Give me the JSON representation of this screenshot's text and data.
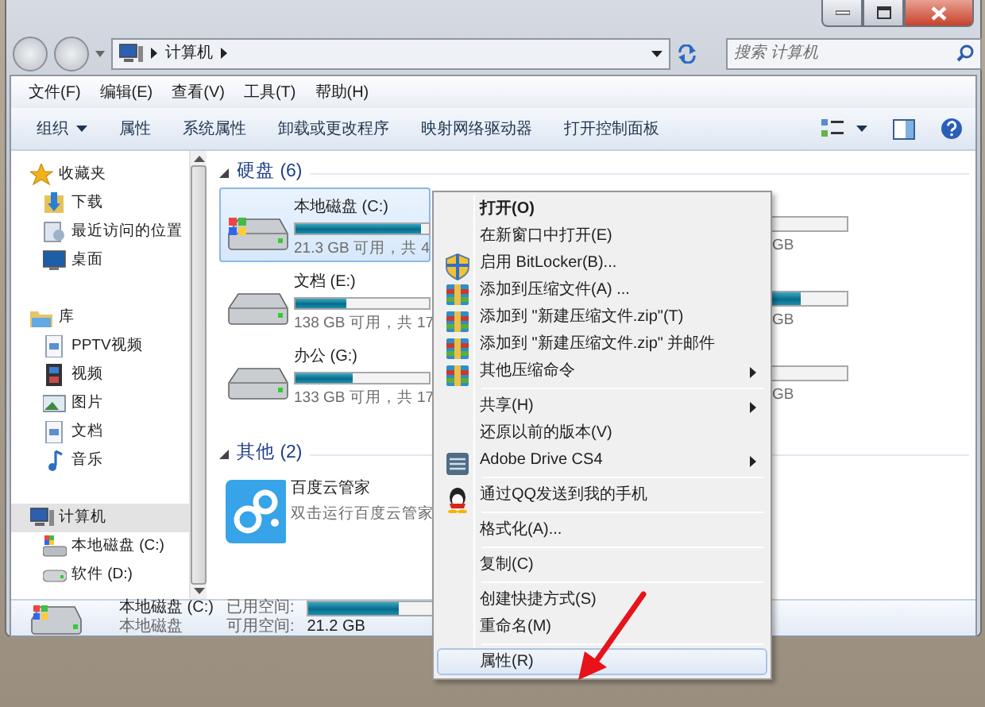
{
  "address_bar": {
    "path": "计算机"
  },
  "search": {
    "placeholder": "搜索 计算机"
  },
  "menu_bar": [
    "文件(F)",
    "编辑(E)",
    "查看(V)",
    "工具(T)",
    "帮助(H)"
  ],
  "toolbar": [
    {
      "label": "组织",
      "dropdown": true
    },
    {
      "label": "属性",
      "dropdown": false
    },
    {
      "label": "系统属性",
      "dropdown": false
    },
    {
      "label": "卸载或更改程序",
      "dropdown": false
    },
    {
      "label": "映射网络驱动器",
      "dropdown": false
    },
    {
      "label": "打开控制面板",
      "dropdown": false
    }
  ],
  "sidebar": {
    "groups": [
      {
        "label": "收藏夹",
        "selected": false,
        "children": [
          {
            "label": "下载",
            "selected": false
          },
          {
            "label": "最近访问的位置",
            "selected": false
          },
          {
            "label": "桌面",
            "selected": false
          }
        ]
      },
      {
        "label": "库",
        "selected": false,
        "children": [
          {
            "label": "PPTV视频",
            "selected": false
          },
          {
            "label": "视频",
            "selected": false
          },
          {
            "label": "图片",
            "selected": false
          },
          {
            "label": "文档",
            "selected": false
          },
          {
            "label": "音乐",
            "selected": false
          }
        ]
      },
      {
        "label": "计算机",
        "selected": true,
        "children": [
          {
            "label": "本地磁盘 (C:)",
            "selected": false
          },
          {
            "label": "软件 (D:)",
            "selected": false
          }
        ]
      }
    ]
  },
  "sections": [
    {
      "title": "硬盘 (6)",
      "expanded": true,
      "tiles": [
        {
          "kind": "drive",
          "name": "本地磁盘 (C:)",
          "level": 0.94,
          "free_text": "21.3 GB 可用，共 4",
          "selected": true
        },
        {
          "kind": "drive",
          "name": "文档 (E:)",
          "level": 0.38,
          "free_text": "138 GB 可用，共 17",
          "selected": false
        },
        {
          "kind": "drive",
          "name": "办公 (G:)",
          "level": 0.43,
          "free_text": "133 GB 可用，共 17",
          "selected": false
        }
      ],
      "right_column": [
        {
          "text": "GB"
        },
        {
          "level": 0.38,
          "text": "GB"
        },
        {
          "text": "GB"
        }
      ]
    },
    {
      "title": "其他 (2)",
      "expanded": true,
      "tiles": [
        {
          "kind": "app",
          "name": "百度云管家",
          "free_text": "双击运行百度云管家",
          "selected": false
        }
      ]
    }
  ],
  "details": {
    "name": "本地磁盘 (C:)",
    "type": "本地磁盘",
    "used_label": "已用空间:",
    "level": 0.6,
    "free_label": "可用空间:",
    "free_value": "21.2 GB"
  },
  "context_menu": {
    "items": [
      {
        "kind": "item",
        "label": "打开(O)",
        "bold": true,
        "submenu": false,
        "highlighted": false
      },
      {
        "kind": "item",
        "label": "在新窗口中打开(E)",
        "bold": false,
        "submenu": false,
        "highlighted": false
      },
      {
        "kind": "item",
        "label": "启用 BitLocker(B)...",
        "bold": false,
        "submenu": false,
        "highlighted": false
      },
      {
        "kind": "item",
        "label": "添加到压缩文件(A) ...",
        "bold": false,
        "submenu": false,
        "highlighted": false
      },
      {
        "kind": "item",
        "label": "添加到 \"新建压缩文件.zip\"(T)",
        "bold": false,
        "submenu": false,
        "highlighted": false
      },
      {
        "kind": "item",
        "label": "添加到 \"新建压缩文件.zip\" 并邮件",
        "bold": false,
        "submenu": false,
        "highlighted": false
      },
      {
        "kind": "item",
        "label": "其他压缩命令",
        "bold": false,
        "submenu": true,
        "highlighted": false
      },
      {
        "kind": "separator"
      },
      {
        "kind": "item",
        "label": "共享(H)",
        "bold": false,
        "submenu": true,
        "highlighted": false
      },
      {
        "kind": "item",
        "label": "还原以前的版本(V)",
        "bold": false,
        "submenu": false,
        "highlighted": false
      },
      {
        "kind": "item",
        "label": "Adobe Drive CS4",
        "bold": false,
        "submenu": true,
        "highlighted": false
      },
      {
        "kind": "separator"
      },
      {
        "kind": "item",
        "label": "通过QQ发送到我的手机",
        "bold": false,
        "submenu": false,
        "highlighted": false
      },
      {
        "kind": "separator"
      },
      {
        "kind": "item",
        "label": "格式化(A)...",
        "bold": false,
        "submenu": false,
        "highlighted": false
      },
      {
        "kind": "separator"
      },
      {
        "kind": "item",
        "label": "复制(C)",
        "bold": false,
        "submenu": false,
        "highlighted": false
      },
      {
        "kind": "separator"
      },
      {
        "kind": "item",
        "label": "创建快捷方式(S)",
        "bold": false,
        "submenu": false,
        "highlighted": false
      },
      {
        "kind": "item",
        "label": "重命名(M)",
        "bold": false,
        "submenu": false,
        "highlighted": false
      },
      {
        "kind": "separator"
      },
      {
        "kind": "item",
        "label": "属性(R)",
        "bold": false,
        "submenu": false,
        "highlighted": true
      }
    ]
  }
}
